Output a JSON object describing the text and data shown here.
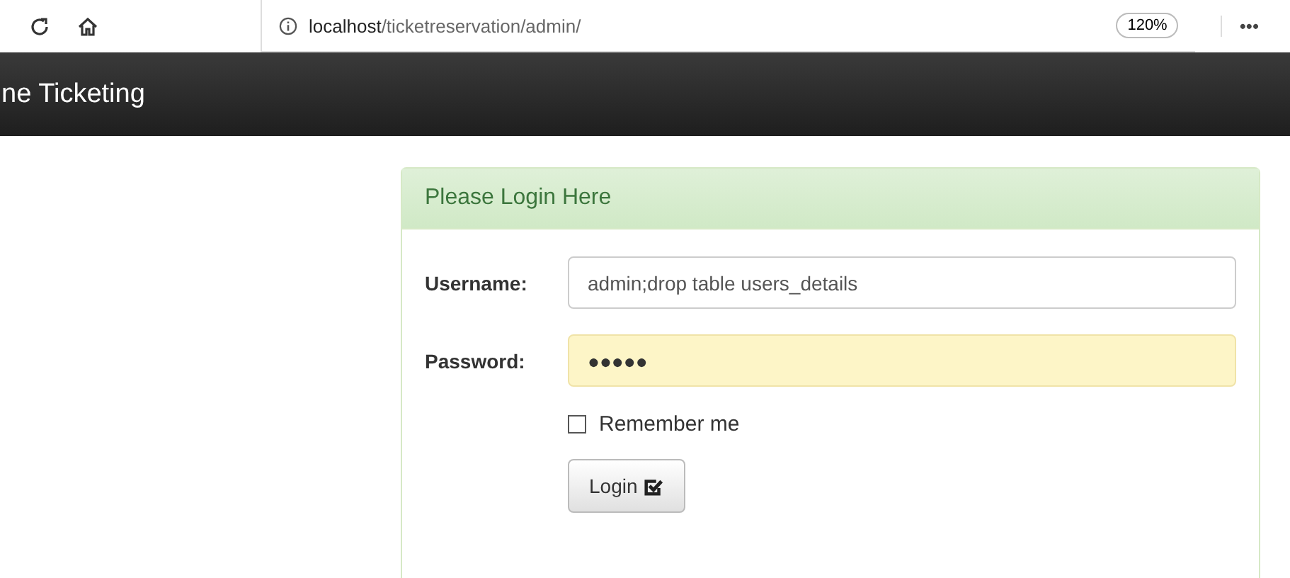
{
  "browser": {
    "address_host": "localhost",
    "address_path": "/ticketreservation/admin/",
    "zoom": "120%",
    "more": "•••"
  },
  "navbar": {
    "brand": "ne Ticketing"
  },
  "panel": {
    "title": "Please Login Here",
    "fields": [
      {
        "label": "Username:",
        "value": "admin;drop table users_details",
        "autofilled": false
      },
      {
        "label": "Password:",
        "value": "●●●●●",
        "autofilled": true
      }
    ],
    "remember": {
      "label": "Remember me",
      "checked": false
    },
    "button": "Login"
  }
}
